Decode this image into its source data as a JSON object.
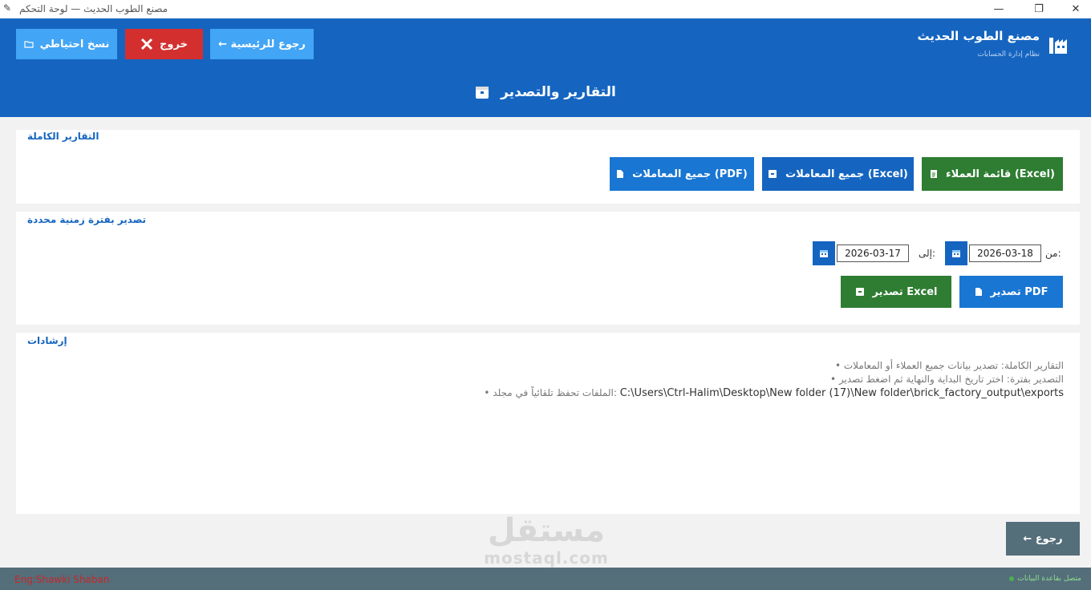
{
  "window": {
    "title": "مصنع الطوب الحديث — لوحة التحكم",
    "minimize": "—",
    "maximize": "❐",
    "close": "✕"
  },
  "header": {
    "backup_label": "نسخ احتياطي",
    "exit_label": "خروج",
    "home_label": "رجوع للرئيسية ←",
    "brand_name": "مصنع الطوب الحديث",
    "brand_sub": "نظام إدارة الحسابات",
    "page_title": "التقارير والتصدير",
    "colors": {
      "header": "#1565c0",
      "exit": "#d32f2f",
      "button": "#42a5f5"
    }
  },
  "full_reports": {
    "title": "التقارير الكاملة",
    "customers_excel": "(Excel) قائمة العملاء",
    "transactions_excel": "(Excel) جميع المعاملات",
    "transactions_pdf": "(PDF) جميع المعاملات"
  },
  "period_export": {
    "title": "تصدير بفترة زمنية محددة",
    "from_label": ":من",
    "from_value": "2026-03-18",
    "to_label": ":إلى",
    "to_value": "2026-03-17",
    "pdf_label": "PDF تصدير",
    "excel_label": "Excel تصدير"
  },
  "instructions": {
    "title": "إرشادات",
    "tip1": "التقارير الكاملة: تصدير بيانات جميع العملاء أو المعاملات •",
    "tip2": "التصدير بفترة: اختر تاريخ البداية والنهاية ثم اضغط تصدير •",
    "tip3_text": ":الملفات تحفظ تلقائياً في مجلد •",
    "tip3_path": "C:\\Users\\Ctrl-Halim\\Desktop\\New folder (17)\\New folder\\brick_factory_output\\exports"
  },
  "footer": {
    "back_label": "رجوع ←",
    "author": "Eng:Shawki Shaban",
    "db_status": "متصل بقاعدة البيانات"
  },
  "watermark": {
    "arabic": "مستقل",
    "latin": "mostaql.com"
  }
}
